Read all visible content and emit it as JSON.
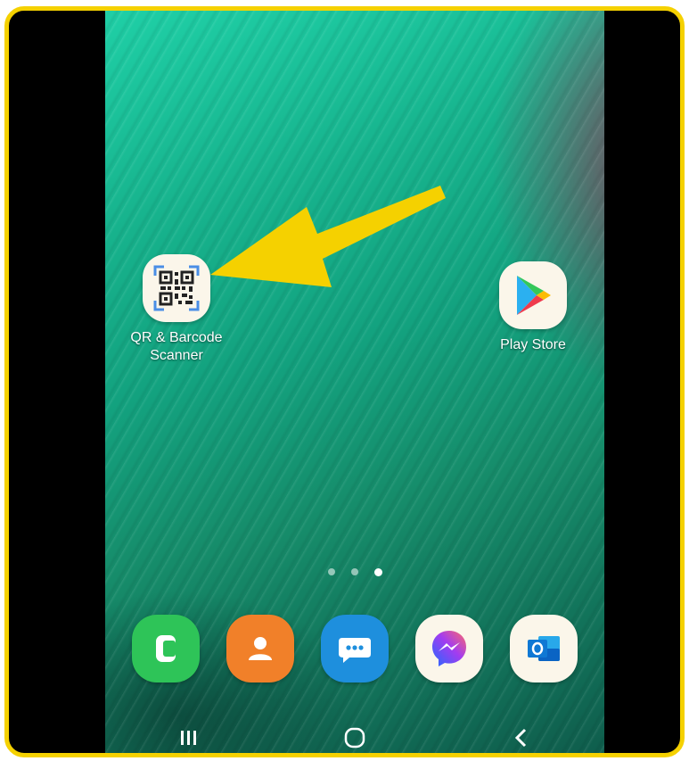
{
  "home_screen": {
    "apps": [
      {
        "label": "QR & Barcode Scanner",
        "icon": "qr-code-icon"
      },
      {
        "label": "Play Store",
        "icon": "play-store-icon"
      }
    ],
    "page_indicator": {
      "pages": 3,
      "active_index": 2
    }
  },
  "dock": {
    "apps": [
      {
        "name": "phone",
        "icon": "phone-icon",
        "color": "#2ec458"
      },
      {
        "name": "contacts",
        "icon": "contacts-icon",
        "color": "#f18029"
      },
      {
        "name": "messages",
        "icon": "messages-icon",
        "color": "#1e8fdd"
      },
      {
        "name": "messenger",
        "icon": "messenger-icon",
        "color": "#fbf6ea"
      },
      {
        "name": "outlook",
        "icon": "outlook-icon",
        "color": "#fbf6ea"
      }
    ]
  },
  "navigation_bar": {
    "buttons": [
      {
        "name": "recent-apps",
        "icon": "recents-icon"
      },
      {
        "name": "home",
        "icon": "home-icon"
      },
      {
        "name": "back",
        "icon": "back-icon"
      }
    ]
  },
  "annotation": {
    "color": "#f5d100",
    "icon": "arrow-icon"
  }
}
